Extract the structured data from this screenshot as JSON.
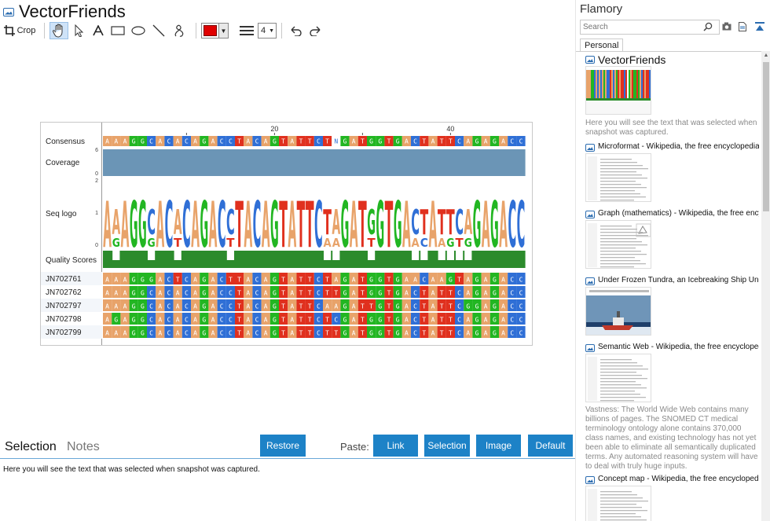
{
  "app": {
    "title": "VectorFriends",
    "toolbar": {
      "crop_label": "Crop",
      "line_width": "4",
      "color": "#e00000"
    }
  },
  "viewer": {
    "ruler_labels": [
      "20",
      "40"
    ],
    "row_labels": [
      "Consensus",
      "Coverage",
      "Seq logo",
      "Quality Scores"
    ],
    "axis_ticks": {
      "coverage": [
        "6",
        "0"
      ],
      "logo": [
        "2",
        "1",
        "0"
      ]
    },
    "sequence_names": [
      "JN702761",
      "JN702762",
      "JN702797",
      "JN702798",
      "JN702799"
    ],
    "consensus": "AAAGGCACACAGACCTACAGTATTCTNGATGGTGACTATTCAGAGACC",
    "sequences": [
      "AAAGGGACTCAGACTTACAGTATTCTAGATGGTGAACAAGTAGAGACC",
      "AAAGGCACACAGACCTACAGTATTCTTGATGGTGACTATTCAGAGACC",
      "AAAGGCACACAGACCTACAGTATTCAAGATTGTGACTATTCGGAGACC",
      "AGAGGCACACAGACCTACAGTATTCTCGATGGTGACTATTCAGAGACC",
      "AAAGGCACACAGACCTACAGTATTCTTGATGGTGACTATTCAGAGACC"
    ],
    "colors": {
      "A": "#e8a36a",
      "C": "#2f6fd6",
      "G": "#22b622",
      "T": "#e0301e",
      "N": "#ffffff"
    }
  },
  "bottom": {
    "tabs": [
      "Selection",
      "Notes"
    ],
    "restore_label": "Restore",
    "paste_label": "Paste:",
    "paste_buttons": [
      "Link",
      "Selection",
      "Image",
      "Default"
    ],
    "selection_text": "Here you will see the text that was selected when snapshot was captured."
  },
  "flamory": {
    "title": "Flamory",
    "search_placeholder": "Search",
    "tab": "Personal",
    "entries": [
      {
        "title": "VectorFriends",
        "desc": "Here you will see the text that was selected when snapshot was captured."
      },
      {
        "title": "Microformat - Wikipedia, the free encyclopedia",
        "desc": ""
      },
      {
        "title": "Graph (mathematics) - Wikipedia, the free ency",
        "desc": ""
      },
      {
        "title": "Under Frozen Tundra, an Icebreaking Ship Unco",
        "desc": ""
      },
      {
        "title": "Semantic Web - Wikipedia, the free encycloped",
        "desc": "Vastness: The World Wide Web contains many billions of pages. The SNOMED CT medical terminology ontology alone contains 370,000 class names, and existing technology has not yet been able to eliminate all semantically duplicated terms. Any automated reasoning system will have to deal with truly huge inputs."
      },
      {
        "title": "Concept map - Wikipedia, the free encyclopedi",
        "desc": ""
      }
    ]
  }
}
